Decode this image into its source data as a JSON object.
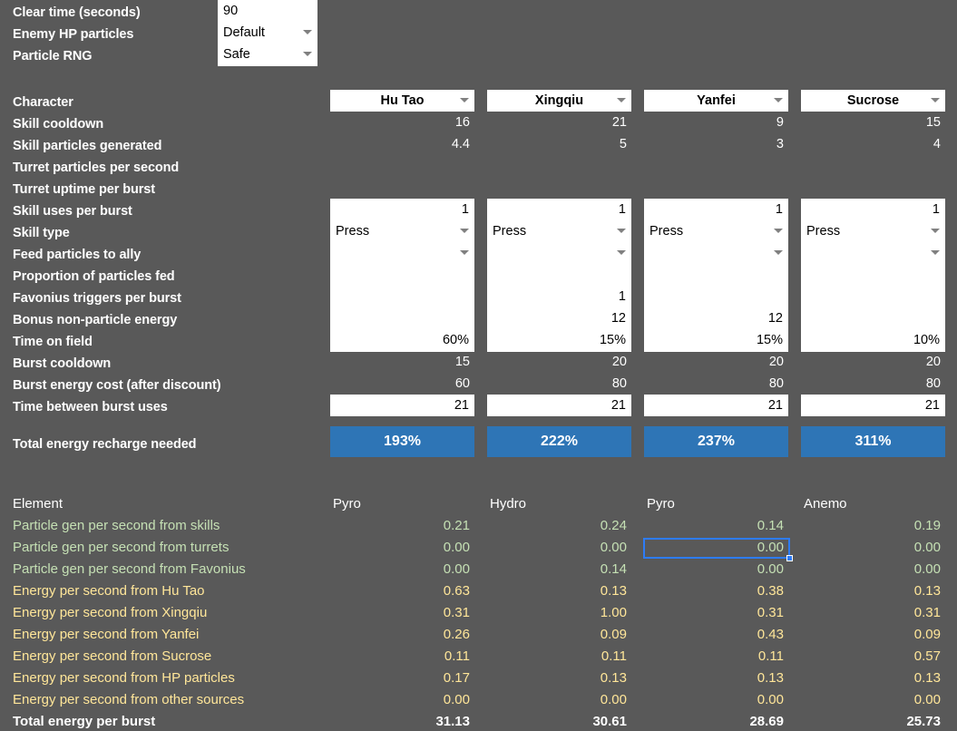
{
  "theme": {
    "background": "#595959",
    "cell_white": "#FFFFFF",
    "accent_blue": "#2E75B6",
    "selection_blue": "#2E7CF6",
    "label_white": "#FFFFFF",
    "green_text": "#C5E0B4",
    "cream_text": "#FFE699"
  },
  "settings": {
    "rows": [
      {
        "label": "Clear time (seconds)",
        "value": "90",
        "type": "text"
      },
      {
        "label": "Enemy HP particles",
        "value": "Default",
        "type": "dropdown"
      },
      {
        "label": "Particle RNG",
        "value": "Safe",
        "type": "dropdown"
      }
    ]
  },
  "table": {
    "row_labels": [
      "Character",
      "Skill cooldown",
      "Skill particles generated",
      "Turret particles per second",
      "Turret uptime per burst",
      "Skill uses per burst",
      "Skill type",
      "Feed particles to ally",
      "Proportion of particles fed",
      "Favonius triggers per burst",
      "Bonus non-particle energy",
      "Time on field",
      "Burst cooldown",
      "Burst energy cost (after discount)",
      "Time between burst uses"
    ],
    "total_label": "Total energy recharge needed",
    "columns": [
      {
        "character": "Hu Tao",
        "skill_cooldown": "16",
        "skill_particles_generated": "4.4",
        "turret_particles_per_second": "",
        "turret_uptime_per_burst": "",
        "skill_uses_per_burst": "1",
        "skill_type": "Press",
        "feed_particles_to_ally": "",
        "proportion_of_particles_fed": "",
        "favonius_triggers_per_burst": "",
        "bonus_non_particle_energy": "",
        "time_on_field": "60%",
        "burst_cooldown": "15",
        "burst_energy_cost": "60",
        "time_between_burst_uses": "21",
        "total_energy_recharge_needed": "193%"
      },
      {
        "character": "Xingqiu",
        "skill_cooldown": "21",
        "skill_particles_generated": "5",
        "turret_particles_per_second": "",
        "turret_uptime_per_burst": "",
        "skill_uses_per_burst": "1",
        "skill_type": "Press",
        "feed_particles_to_ally": "",
        "proportion_of_particles_fed": "",
        "favonius_triggers_per_burst": "1",
        "bonus_non_particle_energy": "12",
        "time_on_field": "15%",
        "burst_cooldown": "20",
        "burst_energy_cost": "80",
        "time_between_burst_uses": "21",
        "total_energy_recharge_needed": "222%"
      },
      {
        "character": "Yanfei",
        "skill_cooldown": "9",
        "skill_particles_generated": "3",
        "turret_particles_per_second": "",
        "turret_uptime_per_burst": "",
        "skill_uses_per_burst": "1",
        "skill_type": "Press",
        "feed_particles_to_ally": "",
        "proportion_of_particles_fed": "",
        "favonius_triggers_per_burst": "",
        "bonus_non_particle_energy": "12",
        "time_on_field": "15%",
        "burst_cooldown": "20",
        "burst_energy_cost": "80",
        "time_between_burst_uses": "21",
        "total_energy_recharge_needed": "237%"
      },
      {
        "character": "Sucrose",
        "skill_cooldown": "15",
        "skill_particles_generated": "4",
        "turret_particles_per_second": "",
        "turret_uptime_per_burst": "",
        "skill_uses_per_burst": "1",
        "skill_type": "Press",
        "feed_particles_to_ally": "",
        "proportion_of_particles_fed": "",
        "favonius_triggers_per_burst": "",
        "bonus_non_particle_energy": "",
        "time_on_field": "10%",
        "burst_cooldown": "20",
        "burst_energy_cost": "80",
        "time_between_burst_uses": "21",
        "total_energy_recharge_needed": "311%"
      }
    ]
  },
  "results": {
    "header_label": "Element",
    "elements": [
      "Pyro",
      "Hydro",
      "Pyro",
      "Anemo"
    ],
    "rows": [
      {
        "label": "Particle gen per second from skills",
        "style": "green",
        "values": [
          "0.21",
          "0.24",
          "0.14",
          "0.19"
        ]
      },
      {
        "label": "Particle gen per second from turrets",
        "style": "green",
        "values": [
          "0.00",
          "0.00",
          "0.00",
          "0.00"
        ]
      },
      {
        "label": "Particle gen per second from Favonius",
        "style": "green",
        "values": [
          "0.00",
          "0.14",
          "0.00",
          "0.00"
        ]
      },
      {
        "label": "Energy per second from Hu Tao",
        "style": "cream",
        "values": [
          "0.63",
          "0.13",
          "0.38",
          "0.13"
        ]
      },
      {
        "label": "Energy per second from Xingqiu",
        "style": "cream",
        "values": [
          "0.31",
          "1.00",
          "0.31",
          "0.31"
        ]
      },
      {
        "label": "Energy per second from Yanfei",
        "style": "cream",
        "values": [
          "0.26",
          "0.09",
          "0.43",
          "0.09"
        ]
      },
      {
        "label": "Energy per second from Sucrose",
        "style": "cream",
        "values": [
          "0.11",
          "0.11",
          "0.11",
          "0.57"
        ]
      },
      {
        "label": "Energy per second  from HP particles",
        "style": "cream",
        "values": [
          "0.17",
          "0.13",
          "0.13",
          "0.13"
        ]
      },
      {
        "label": "Energy per second from other sources",
        "style": "cream",
        "values": [
          "0.00",
          "0.00",
          "0.00",
          "0.00"
        ]
      },
      {
        "label": "Total energy per burst",
        "style": "white",
        "values": [
          "31.13",
          "30.61",
          "28.69",
          "25.73"
        ]
      }
    ]
  },
  "selection": {
    "cell_value": "0.00",
    "column_index": 2,
    "row_index": 1
  }
}
